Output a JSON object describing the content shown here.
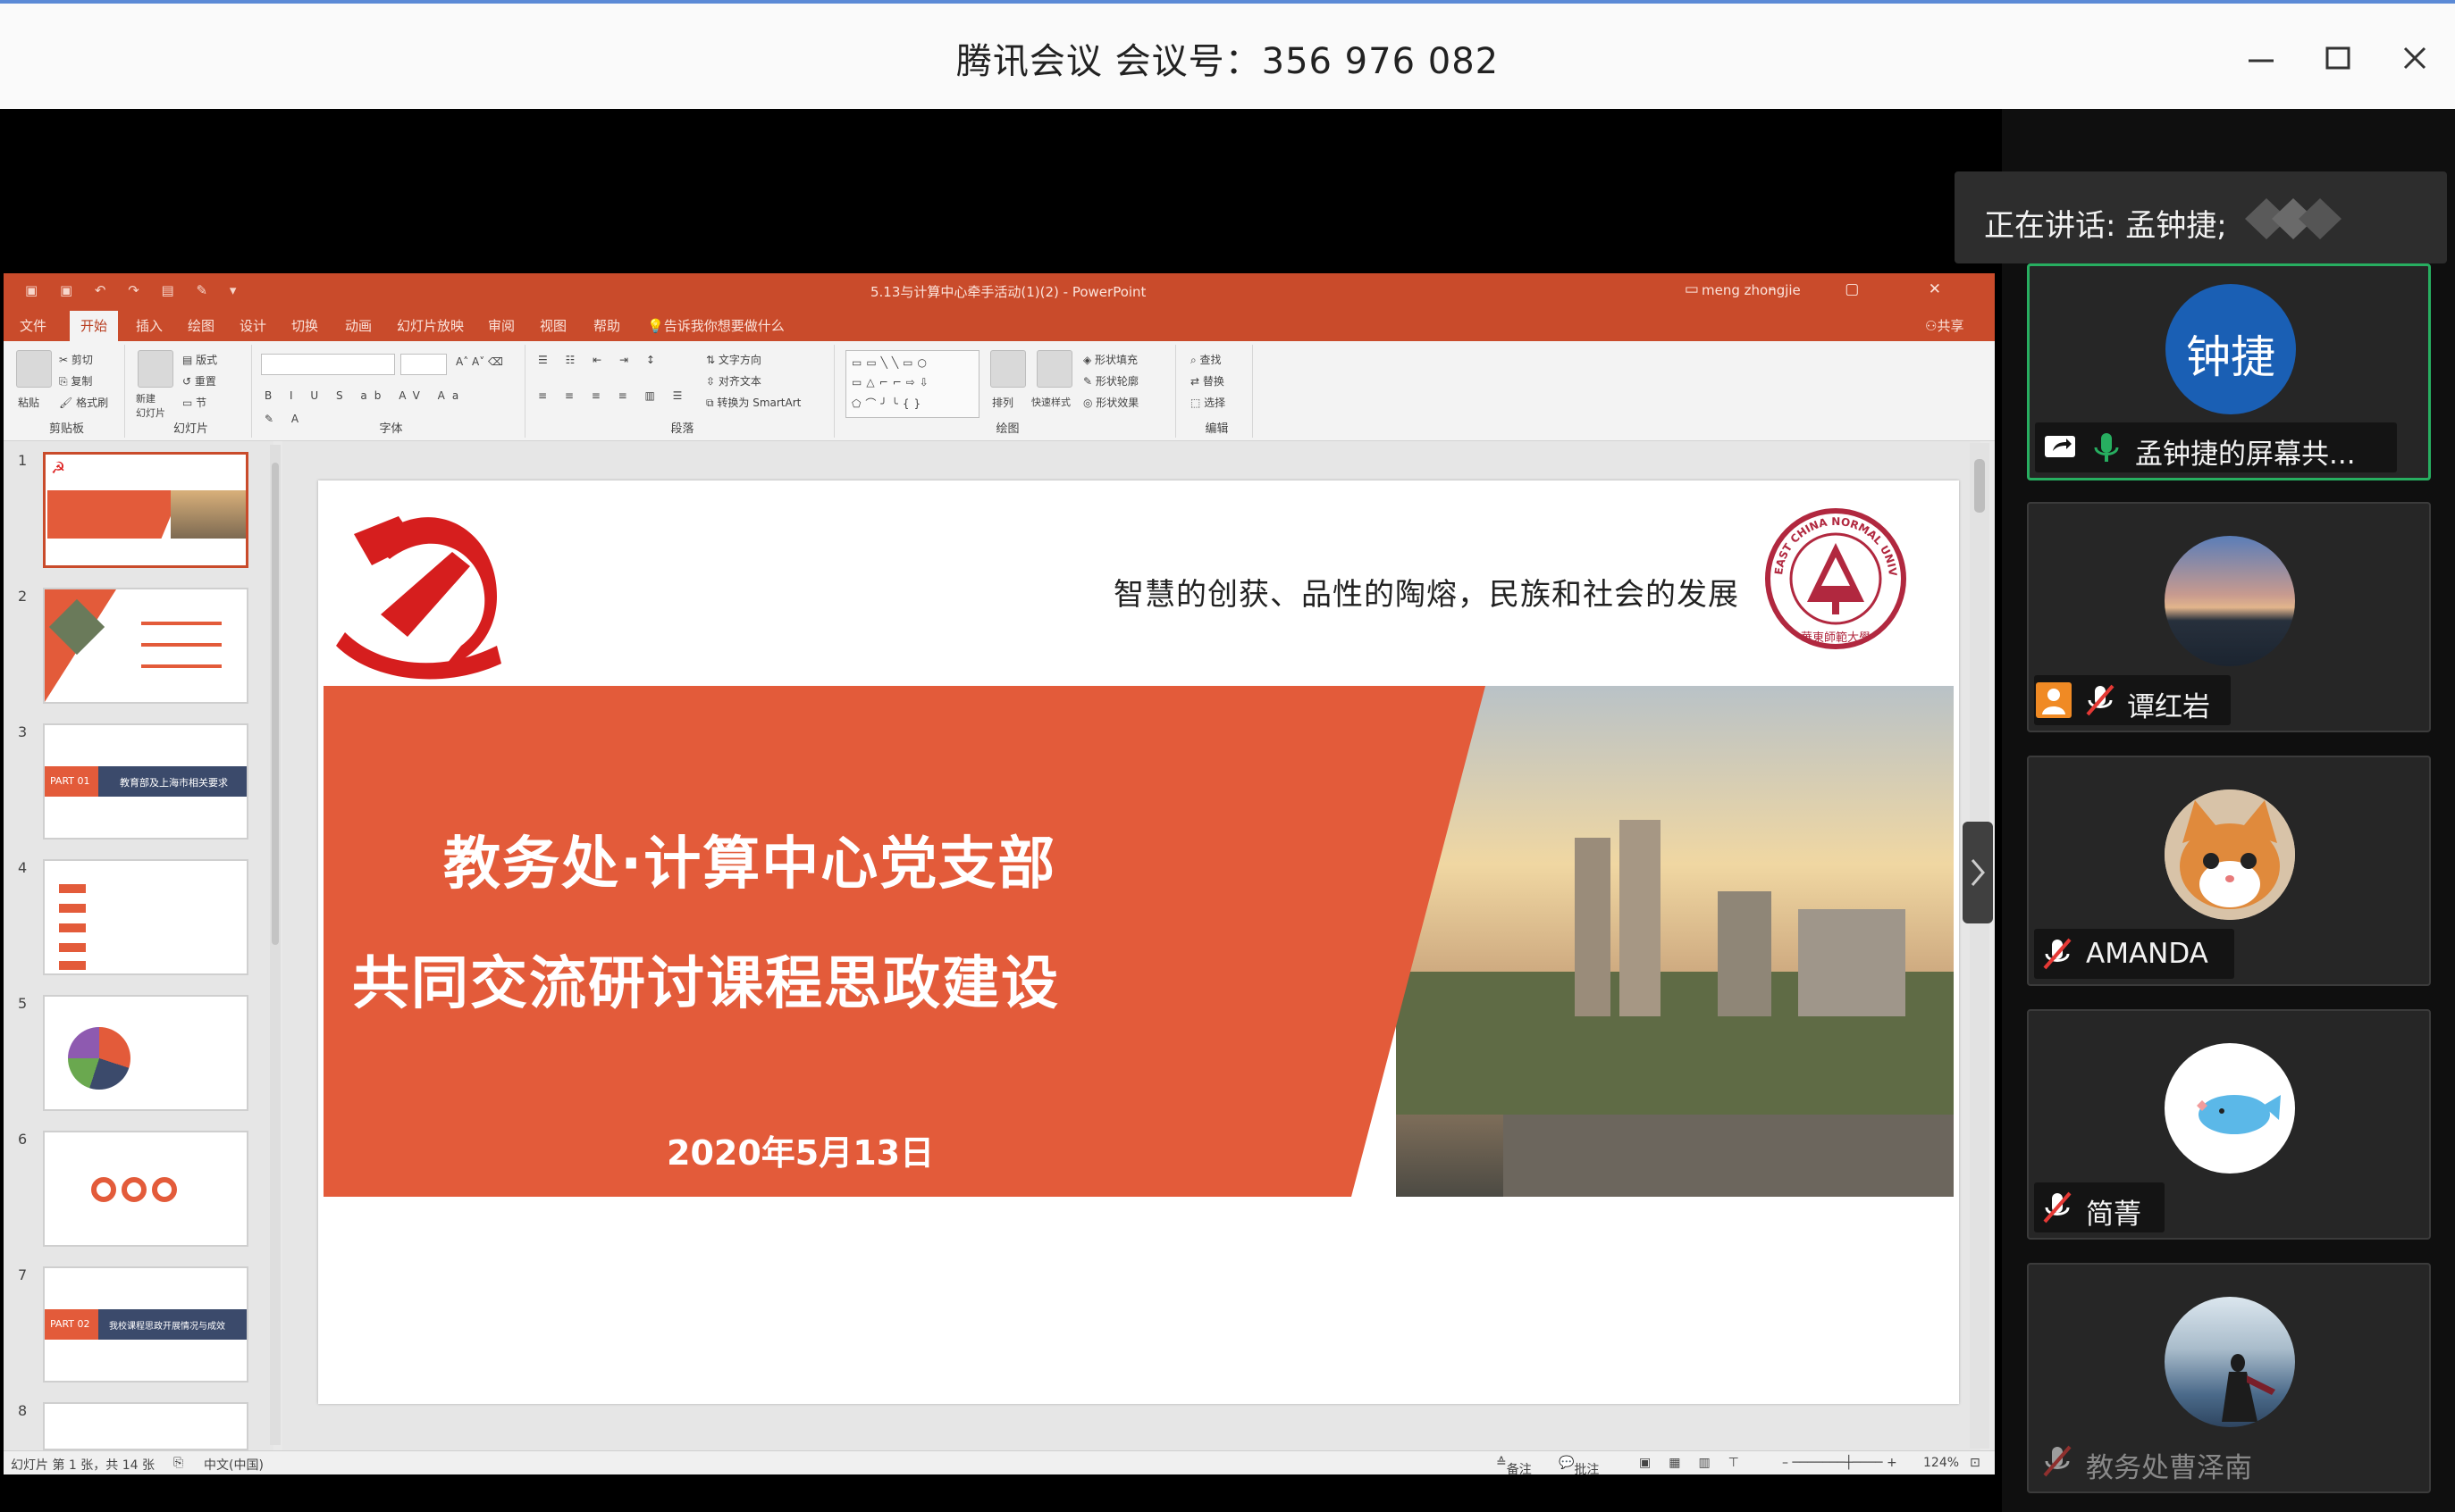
{
  "window": {
    "title": "腾讯会议 会议号：356 976 082",
    "controls": [
      "minimize-icon",
      "maximize-icon",
      "close-icon"
    ]
  },
  "speaking_banner": {
    "label": "正在讲话: 孟钟捷;"
  },
  "participants": [
    {
      "name": "孟钟捷的屏幕共...",
      "avatar_text": "钟捷",
      "avatar_color": "#1a5fb4",
      "status": [
        "screen-share-icon",
        "mic-on-icon"
      ],
      "active": true
    },
    {
      "name": "谭红岩",
      "avatar": "sunset-photo",
      "status": [
        "person-icon",
        "mic-off-icon"
      ]
    },
    {
      "name": "AMANDA",
      "avatar": "kitten-photo",
      "status": [
        "mic-off-icon"
      ]
    },
    {
      "name": "简菁",
      "avatar": "cartoon-whale",
      "status": [
        "mic-off-icon"
      ]
    },
    {
      "name": "教务处曹泽南",
      "avatar": "lakeside-photo",
      "status": [
        "mic-off-icon"
      ]
    }
  ],
  "ppt": {
    "doc_title": "5.13与计算中心牵手活动(1)(2) - PowerPoint",
    "user": "meng zhongjie",
    "tabs": [
      "文件",
      "开始",
      "插入",
      "绘图",
      "设计",
      "切换",
      "动画",
      "幻灯片放映",
      "审阅",
      "视图",
      "帮助"
    ],
    "active_tab": "开始",
    "tell_me": "告诉我你想要做什么",
    "share": "共享",
    "ribbon": {
      "clipboard": {
        "label": "剪贴板",
        "paste": "粘贴",
        "cut": "剪切",
        "copy": "复制",
        "format_painter": "格式刷"
      },
      "slides": {
        "label": "幻灯片",
        "new_slide": "新建\n幻灯片",
        "layout": "版式",
        "reset": "重置",
        "section": "节"
      },
      "font": {
        "label": "字体"
      },
      "paragraph": {
        "label": "段落",
        "text_direction": "文字方向",
        "align_text": "对齐文本",
        "smartart": "转换为 SmartArt"
      },
      "drawing": {
        "label": "绘图",
        "arrange": "排列",
        "quick_styles": "快速样式",
        "fill": "形状填充",
        "outline": "形状轮廓",
        "effects": "形状效果"
      },
      "editing": {
        "label": "编辑",
        "find": "查找",
        "replace": "替换",
        "select": "选择"
      }
    },
    "thumbnails": [
      "1",
      "2",
      "3",
      "4",
      "5",
      "6",
      "7",
      "8"
    ],
    "thumb_labels": {
      "t3": "教育部及上海市相关要求",
      "t7": "我校课程思政开展情况与成效",
      "part1": "PART 01",
      "part2": "PART 02"
    },
    "slide": {
      "motto": "智慧的创获、品性的陶熔，民族和社会的发展",
      "title_line1": "教务处·计算中心党支部",
      "title_line2": "共同交流研讨课程思政建设",
      "date": "2020年5月13日",
      "logo_text": "EAST CHINA NORMAL UNIVERSITY",
      "logo_cn": "華東師範大學"
    },
    "status": {
      "slide_info": "幻灯片 第 1 张，共 14 张",
      "lang": "中文(中国)",
      "notes": "备注",
      "comments": "批注",
      "zoom": "124%"
    }
  },
  "colors": {
    "ppt_accent": "#c94b2b",
    "slide_red": "#e35b3a",
    "active_border": "#27ae60"
  }
}
